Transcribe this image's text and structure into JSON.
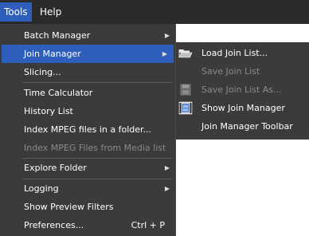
{
  "menubar": {
    "tools": "Tools",
    "help": "Help"
  },
  "tools_menu": {
    "items": [
      {
        "label": "Batch Manager",
        "submenu": true
      },
      {
        "label": "Join Manager",
        "submenu": true,
        "highlighted": true
      },
      {
        "label": "Slicing..."
      },
      {
        "label": "Time Calculator"
      },
      {
        "label": "History List"
      },
      {
        "label": "Index MPEG files in a folder..."
      },
      {
        "label": "Index MPEG Files from Media list",
        "disabled": true
      },
      {
        "label": "Explore Folder",
        "submenu": true
      },
      {
        "label": "Logging",
        "submenu": true
      },
      {
        "label": "Show Preview Filters"
      },
      {
        "label": "Preferences...",
        "shortcut": "Ctrl + P"
      }
    ]
  },
  "join_menu": {
    "items": [
      {
        "label": "Load Join List...",
        "icon": "folder-open-icon"
      },
      {
        "label": "Save Join List",
        "disabled": true
      },
      {
        "label": "Save Join List As...",
        "disabled": true,
        "icon": "save-icon"
      },
      {
        "label": "Show Join Manager",
        "icon": "film-icon"
      },
      {
        "label": "Join Manager Toolbar"
      }
    ]
  },
  "colors": {
    "menu_bg": "#3b3b3b",
    "menubar_bg": "#2b2b2b",
    "highlight": "#2f5fbd",
    "disabled_text": "#8a8a8a"
  }
}
